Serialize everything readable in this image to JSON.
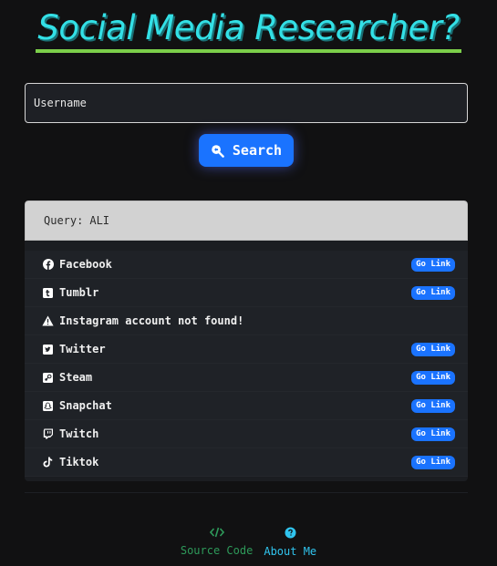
{
  "header": {
    "title": "Social Media Researcher?"
  },
  "search": {
    "placeholder": "Username",
    "button_label": "Search"
  },
  "query": {
    "label": "Query:",
    "value": "ALI"
  },
  "results": [
    {
      "icon": "facebook-icon",
      "label": "Facebook",
      "link": "Go Link"
    },
    {
      "icon": "tumblr-icon",
      "label": "Tumblr",
      "link": "Go Link"
    },
    {
      "icon": "warning-icon",
      "label": "Instagram account not found!",
      "link": ""
    },
    {
      "icon": "twitter-icon",
      "label": "Twitter",
      "link": "Go Link"
    },
    {
      "icon": "steam-icon",
      "label": "Steam",
      "link": "Go Link"
    },
    {
      "icon": "snapchat-icon",
      "label": "Snapchat",
      "link": "Go Link"
    },
    {
      "icon": "twitch-icon",
      "label": "Twitch",
      "link": "Go Link"
    },
    {
      "icon": "tiktok-icon",
      "label": "Tiktok",
      "link": "Go Link"
    }
  ],
  "footer": {
    "source_label": "Source Code",
    "about_label": "About Me"
  },
  "colors": {
    "title": "#33e0e6",
    "title_underline": "#7ccf4a",
    "accent": "#1a73ff",
    "source": "#2e9a5a",
    "about": "#30c4ee"
  }
}
